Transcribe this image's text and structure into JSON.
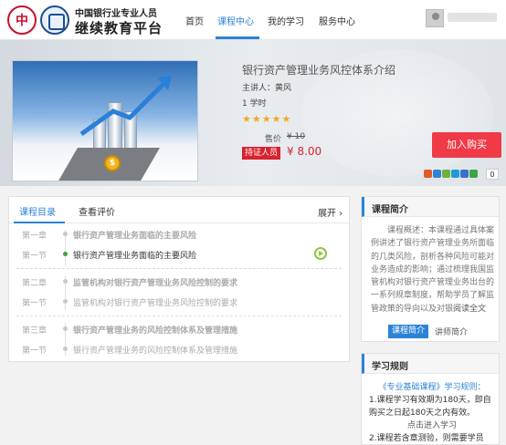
{
  "header": {
    "logo_text": "中",
    "brand_top": "中国银行业专业人员",
    "brand_main": "继续教育平台",
    "nav": [
      "首页",
      "课程中心",
      "我的学习",
      "服务中心"
    ],
    "active_nav": "课程中心"
  },
  "course": {
    "title": "银行资产管理业务风控体系介绍",
    "lecturer": "主讲人：黄风",
    "hours": "1 学时",
    "rating": "★★★★★",
    "price_label": "售价",
    "original_price": "¥ 10",
    "member_tag": "持证人员",
    "member_price": "¥ 8.00",
    "enroll_button": "加入购买",
    "share_count": "0",
    "coin_symbol": "$",
    "brand_colors": {
      "accent": "#2b83d6",
      "buy": "#f03a47",
      "price": "#d9232e"
    }
  },
  "catalog": {
    "tabs": [
      "课程目录",
      "查看评价"
    ],
    "expand_label": "展开",
    "expand_icon": "chevron-right-icon",
    "rows": [
      {
        "label": "第一章",
        "text": "银行资产管理业务面临的主要风险"
      },
      {
        "label": "第一节",
        "text": "银行资产管理业务面临的主要风险"
      },
      {
        "label": "第二章",
        "text": "监管机构对银行资产管理业务风险控制的要求"
      },
      {
        "label": "第一节",
        "text": "监管机构对银行资产管理业务风险控制的要求"
      },
      {
        "label": "第三章",
        "text": "银行资产管理业务的风险控制体系及管理措施"
      },
      {
        "label": "第一节",
        "text": "银行资产管理业务的风险控制体系及管理措施"
      }
    ]
  },
  "intro": {
    "heading": "课程简介",
    "body": "课程概述：本课程通过具体案例讲述了银行资产管理业务所面临的几类风险，剖析各种风险可能对业务造成的影响；通过梳理我国监管机构对银行资产管理业务出台的一系列规章制度，帮助学员了解监管政策的导向以及对银",
    "read_more": "阅读全文",
    "intro_button": "课程简介",
    "teacher_link": "讲师简介"
  },
  "rules": {
    "heading": "学习规则",
    "intro_prefix": "《专业基础课程》",
    "intro_suffix": "学习规则：",
    "item1": "1.课程学习有效期为180天，即自购买之日起180天之内有效。",
    "item1_note": "点击进入学习",
    "item2": "2.课程若含章测验，则需要学员"
  }
}
